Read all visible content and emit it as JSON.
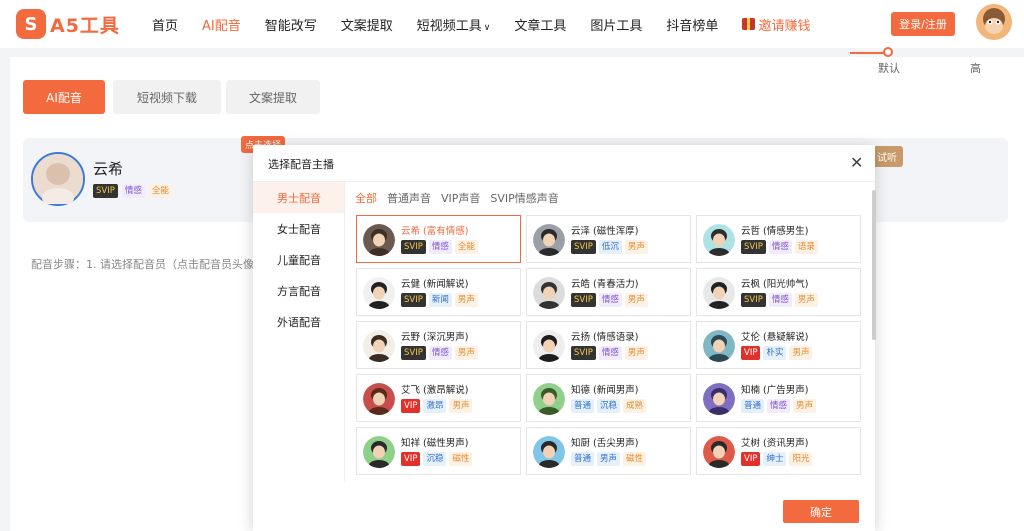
{
  "brand": {
    "logo_text": "A5工具"
  },
  "nav": {
    "items": [
      "首页",
      "AI配音",
      "智能改写",
      "文案提取",
      "短视频工具",
      "文章工具",
      "图片工具",
      "抖音榜单"
    ],
    "invite": "邀请赚钱",
    "login": "登录/注册"
  },
  "tabs": [
    "AI配音",
    "短视频下载",
    "文案提取"
  ],
  "current_voice": {
    "name": "云希",
    "tags": [
      "SVIP",
      "情感",
      "全能"
    ],
    "hot": "点击选择",
    "speed_btn": "试听",
    "slider_labels": [
      "默认",
      "高"
    ]
  },
  "steps_text": "配音步骤：1. 请选择配音员（点击配音员头像",
  "modal": {
    "title": "选择配音主播",
    "categories": [
      "男士配音",
      "女士配音",
      "儿童配音",
      "方言配音",
      "外语配音"
    ],
    "filters": [
      "全部",
      "普通声音",
      "VIP声音",
      "SVIP情感声音"
    ],
    "voices": [
      {
        "name": "云希 (富有情感)",
        "tags": [
          "SVIP",
          "情感",
          "全能"
        ]
      },
      {
        "name": "云泽 (磁性浑厚)",
        "tags": [
          "SVIP",
          "低沉",
          "男声"
        ]
      },
      {
        "name": "云哲 (情感男生)",
        "tags": [
          "SVIP",
          "情感",
          "语录"
        ]
      },
      {
        "name": "云健 (新闻解说)",
        "tags": [
          "SVIP",
          "新闻",
          "男声"
        ]
      },
      {
        "name": "云皓 (青春活力)",
        "tags": [
          "SVIP",
          "情感",
          "男声"
        ]
      },
      {
        "name": "云枫 (阳光帅气)",
        "tags": [
          "SVIP",
          "情感",
          "男声"
        ]
      },
      {
        "name": "云野 (深沉男声)",
        "tags": [
          "SVIP",
          "情感",
          "男声"
        ]
      },
      {
        "name": "云扬 (情感语录)",
        "tags": [
          "SVIP",
          "情感",
          "男声"
        ]
      },
      {
        "name": "艾伦 (悬疑解说)",
        "tags": [
          "VIP",
          "朴实",
          "男声"
        ]
      },
      {
        "name": "艾飞 (激昂解说)",
        "tags": [
          "VIP",
          "激昂",
          "男声"
        ]
      },
      {
        "name": "知德 (新闻男声)",
        "tags": [
          "普通",
          "沉稳",
          "成熟"
        ]
      },
      {
        "name": "知楠 (广告男声)",
        "tags": [
          "普通",
          "情感",
          "男声"
        ]
      },
      {
        "name": "知祥 (磁性男声)",
        "tags": [
          "VIP",
          "沉稳",
          "磁性"
        ]
      },
      {
        "name": "知厨 (舌尖男声)",
        "tags": [
          "普通",
          "男声",
          "磁性"
        ]
      },
      {
        "name": "艾树 (资讯男声)",
        "tags": [
          "VIP",
          "绅士",
          "阳光"
        ]
      }
    ],
    "confirm": "确定"
  }
}
